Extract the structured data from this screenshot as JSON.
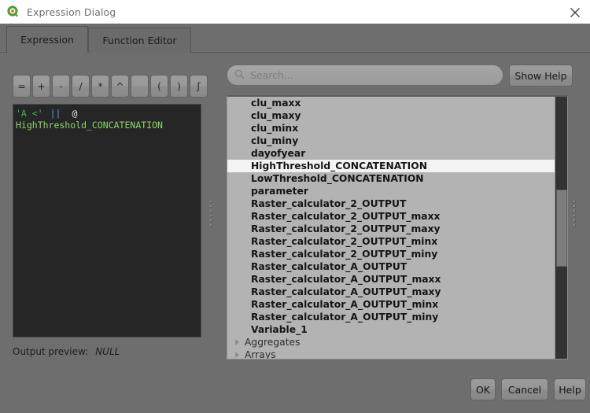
{
  "window": {
    "title": "Expression Dialog",
    "logo_icon": "qgis-logo-icon",
    "close_icon": "close-icon"
  },
  "tabs": [
    {
      "label": "Expression",
      "selected": true
    },
    {
      "label": "Function Editor",
      "selected": false
    }
  ],
  "operators": [
    {
      "label": "=",
      "name": "operator-equals"
    },
    {
      "label": "+",
      "name": "operator-plus"
    },
    {
      "label": "-",
      "name": "operator-minus"
    },
    {
      "label": "/",
      "name": "operator-divide"
    },
    {
      "label": "*",
      "name": "operator-multiply"
    },
    {
      "label": "^",
      "name": "operator-power"
    },
    {
      "label": "",
      "name": "operator-concat"
    },
    {
      "label": "(",
      "name": "operator-paren-open"
    },
    {
      "label": ")",
      "name": "operator-paren-close"
    },
    {
      "label": "ʃ",
      "name": "operator-newline"
    }
  ],
  "editor": {
    "line1": {
      "string": "'A <'",
      "operator": "||",
      "at": "@"
    },
    "line2": "HighThreshold_CONCATENATION"
  },
  "output_preview": {
    "label": "Output preview:",
    "value": "NULL"
  },
  "search": {
    "placeholder": "Search...",
    "icon": "search-icon",
    "value": ""
  },
  "show_help_button": "Show Help",
  "tree": {
    "items": [
      {
        "label": "clu_maxx",
        "kind": "variable",
        "selected": false
      },
      {
        "label": "clu_maxy",
        "kind": "variable",
        "selected": false
      },
      {
        "label": "clu_minx",
        "kind": "variable",
        "selected": false
      },
      {
        "label": "clu_miny",
        "kind": "variable",
        "selected": false
      },
      {
        "label": "dayofyear",
        "kind": "variable",
        "selected": false
      },
      {
        "label": "HighThreshold_CONCATENATION",
        "kind": "variable",
        "selected": true
      },
      {
        "label": "LowThreshold_CONCATENATION",
        "kind": "variable",
        "selected": false
      },
      {
        "label": "parameter",
        "kind": "variable",
        "selected": false
      },
      {
        "label": "Raster_calculator_2_OUTPUT",
        "kind": "variable",
        "selected": false
      },
      {
        "label": "Raster_calculator_2_OUTPUT_maxx",
        "kind": "variable",
        "selected": false
      },
      {
        "label": "Raster_calculator_2_OUTPUT_maxy",
        "kind": "variable",
        "selected": false
      },
      {
        "label": "Raster_calculator_2_OUTPUT_minx",
        "kind": "variable",
        "selected": false
      },
      {
        "label": "Raster_calculator_2_OUTPUT_miny",
        "kind": "variable",
        "selected": false
      },
      {
        "label": "Raster_calculator_A_OUTPUT",
        "kind": "variable",
        "selected": false
      },
      {
        "label": "Raster_calculator_A_OUTPUT_maxx",
        "kind": "variable",
        "selected": false
      },
      {
        "label": "Raster_calculator_A_OUTPUT_maxy",
        "kind": "variable",
        "selected": false
      },
      {
        "label": "Raster_calculator_A_OUTPUT_minx",
        "kind": "variable",
        "selected": false
      },
      {
        "label": "Raster_calculator_A_OUTPUT_miny",
        "kind": "variable",
        "selected": false
      },
      {
        "label": "Variable_1",
        "kind": "variable",
        "selected": false
      },
      {
        "label": "Aggregates",
        "kind": "group",
        "selected": false
      },
      {
        "label": "Arrays",
        "kind": "group",
        "selected": false
      }
    ]
  },
  "footer": {
    "ok": "OK",
    "cancel": "Cancel",
    "help": "Help"
  },
  "colors": {
    "dialog_bg": "#6e6e6e",
    "editor_bg": "#262626",
    "tree_bg": "#b3b3b3",
    "selection_bg": "#f3f3f3",
    "string_token": "#44b544",
    "operator_token": "#5f9ee0",
    "identifier_token": "#8ed66a",
    "logo_green": "#4c9b2f",
    "logo_orange": "#e0761f"
  }
}
